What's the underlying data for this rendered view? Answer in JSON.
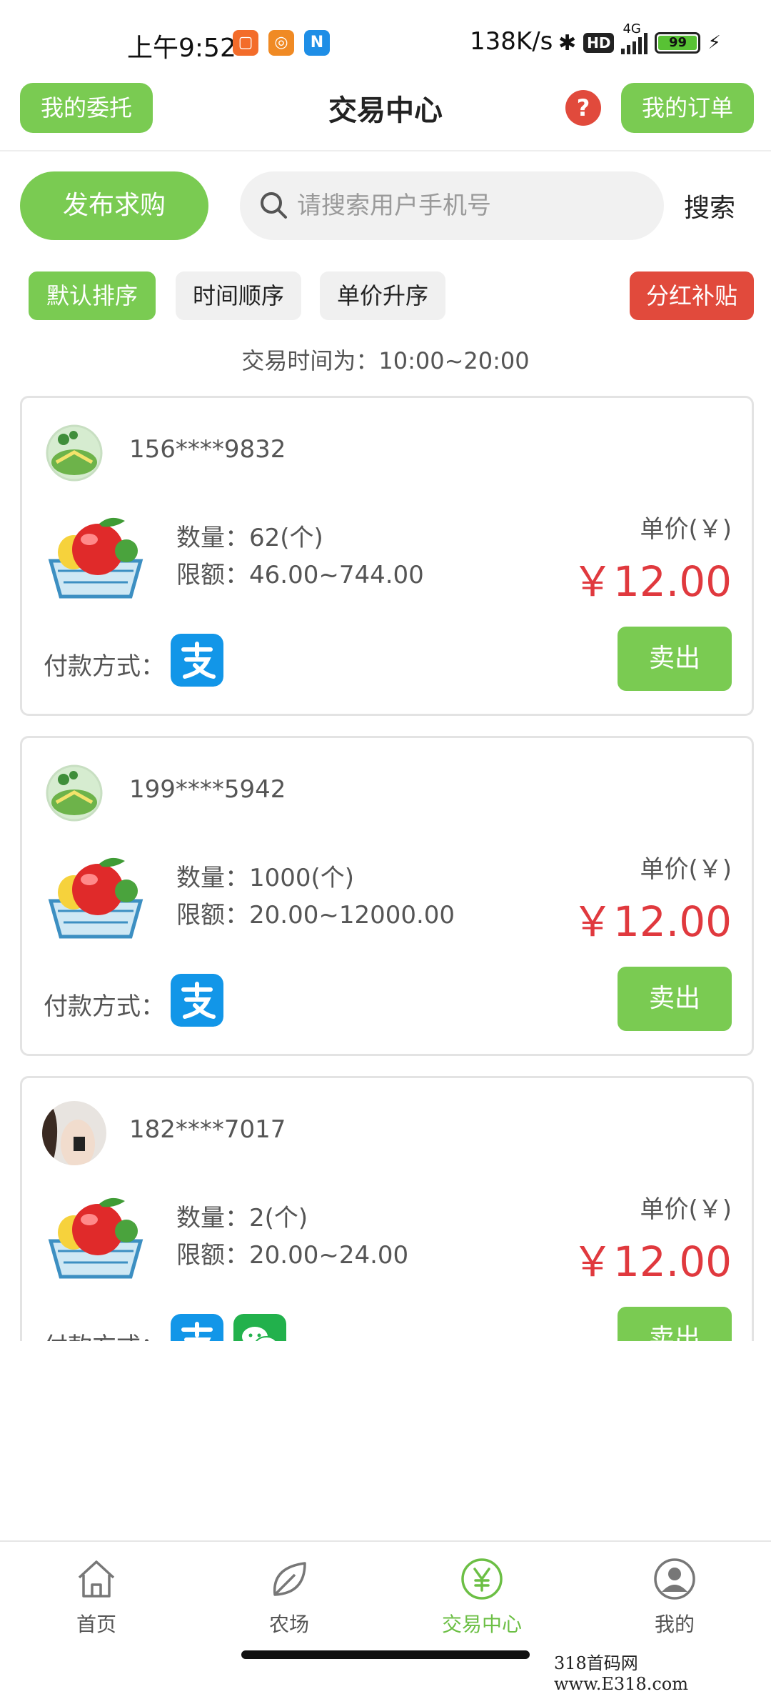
{
  "status_bar": {
    "time": "上午9:52",
    "network_speed": "138K/s",
    "hd_badge": "HD",
    "network_type": "4G",
    "battery": "99"
  },
  "header": {
    "left_button": "我的委托",
    "title": "交易中心",
    "help": "?",
    "right_button": "我的订单"
  },
  "search": {
    "publish_button": "发布求购",
    "placeholder": "请搜索用户手机号",
    "search_button": "搜索"
  },
  "sort_tabs": [
    "默认排序",
    "时间顺序",
    "单价升序"
  ],
  "bonus_button": "分红补贴",
  "trade_time": "交易时间为：10:00~20:00",
  "colors": {
    "accent_green": "#7acb52",
    "price_red": "#e0393e",
    "bonus_red": "#e14a3c"
  },
  "listings": [
    {
      "phone": "156****9832",
      "quantity": "数量：62(个)",
      "limit": "限额：46.00~744.00",
      "unit_label": "单价(￥)",
      "price": "￥12.00",
      "pay_label": "付款方式：",
      "payment": [
        "alipay"
      ],
      "sell": "卖出",
      "avatar": "farm-avatar-icon"
    },
    {
      "phone": "199****5942",
      "quantity": "数量：1000(个)",
      "limit": "限额：20.00~12000.00",
      "unit_label": "单价(￥)",
      "price": "￥12.00",
      "pay_label": "付款方式：",
      "payment": [
        "alipay"
      ],
      "sell": "卖出",
      "avatar": "farm-avatar-icon"
    },
    {
      "phone": "182****7017",
      "quantity": "数量：2(个)",
      "limit": "限额：20.00~24.00",
      "unit_label": "单价(￥)",
      "price": "￥12.00",
      "pay_label": "付款方式：",
      "payment": [
        "alipay",
        "wechat"
      ],
      "sell": "卖出",
      "avatar": "photo-avatar"
    }
  ],
  "tabbar": [
    {
      "label": "首页",
      "icon": "home-icon"
    },
    {
      "label": "农场",
      "icon": "leaf-icon"
    },
    {
      "label": "交易中心",
      "icon": "yen-icon",
      "active": true
    },
    {
      "label": "我的",
      "icon": "user-icon"
    }
  ],
  "watermark": "318首码网  www.E318.com"
}
